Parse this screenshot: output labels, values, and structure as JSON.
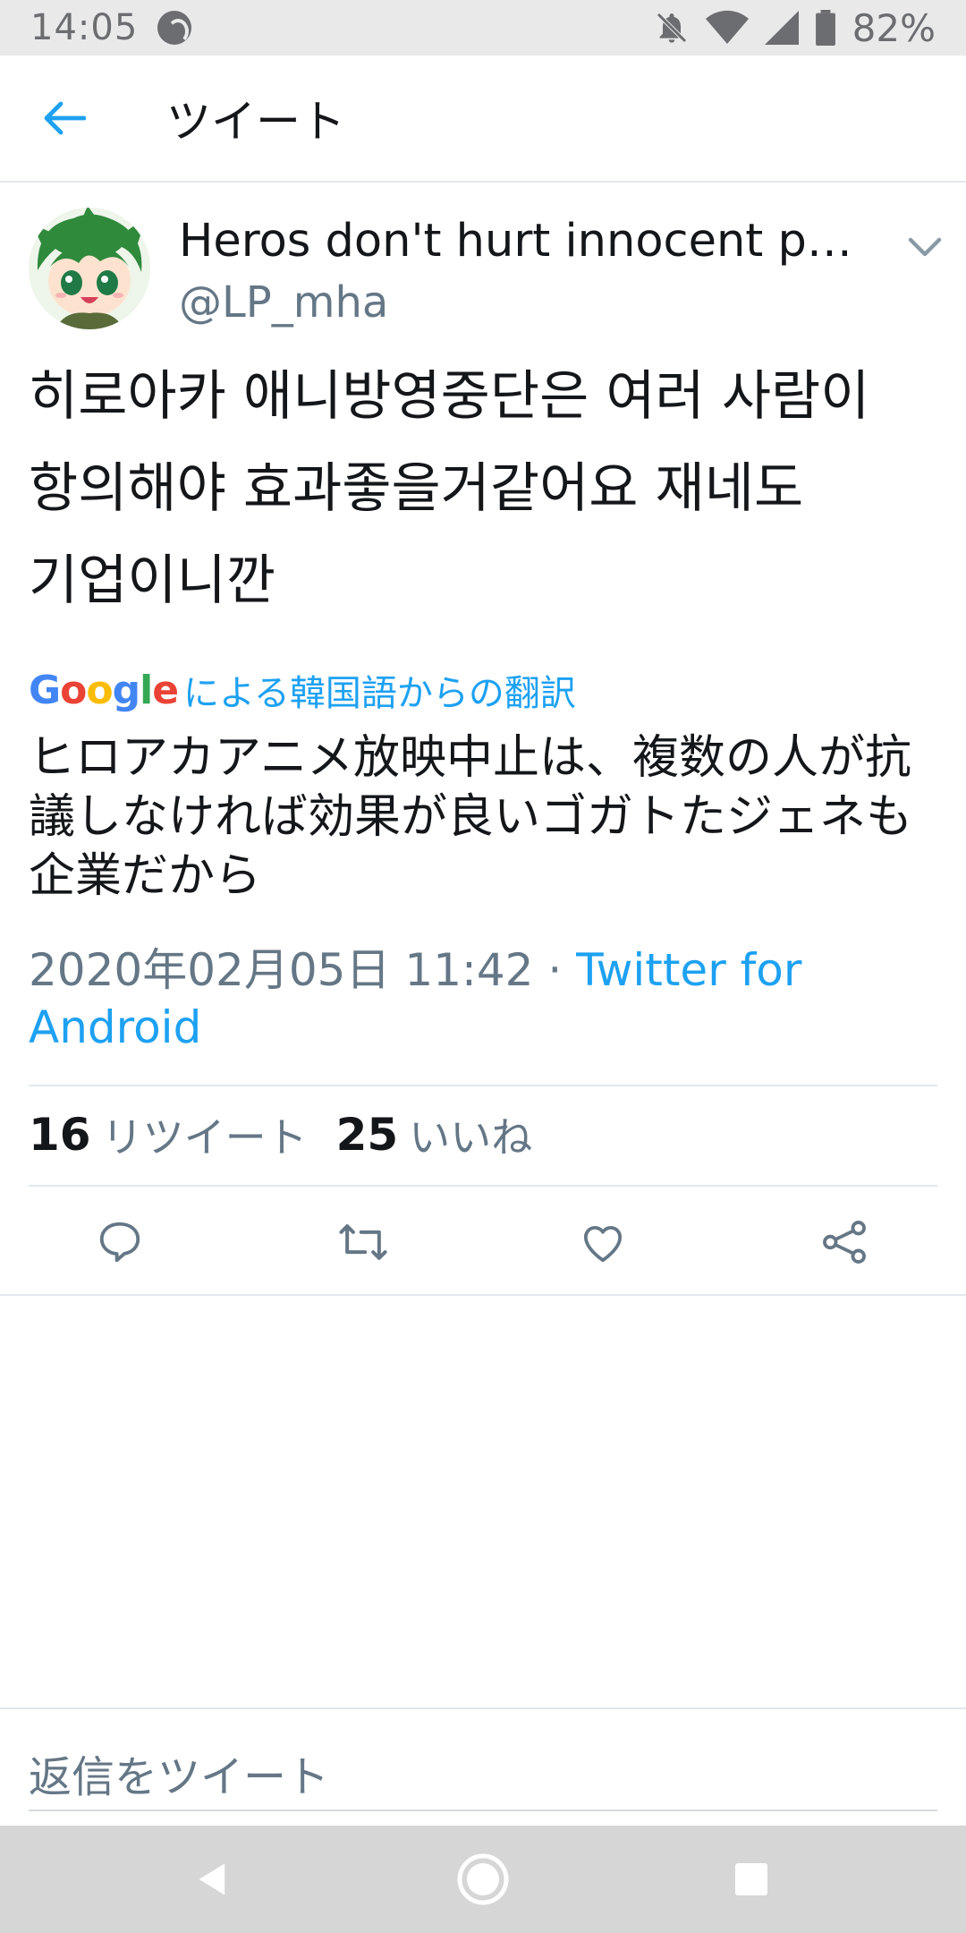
{
  "status_bar": {
    "time": "14:05",
    "battery": "82%",
    "icons": [
      "cast-icon",
      "mute-icon",
      "wifi-icon",
      "signal-icon",
      "battery-icon"
    ]
  },
  "app_bar": {
    "title": "ツイート",
    "back_icon": "arrow-left-icon"
  },
  "tweet": {
    "display_name": "Heros don't hurt innocent pe…",
    "handle": "@LP_mha",
    "text": "히로아카 애니방영중단은 여러 사람이 항의해야 효과좋을거같어요 재네도 기업이니깐",
    "translation_label": {
      "brand": "Google",
      "text": "による韓国語からの翻訳"
    },
    "translated_text": "ヒロアカアニメ放映中止は、複数の人が抗議しなければ効果が良いゴガトたジェネも企業だから",
    "timestamp": "2020年02月05日 11:42",
    "separator": " · ",
    "source": "Twitter for Android",
    "stats": {
      "retweets_count": "16",
      "retweets_label": "リツイート",
      "likes_count": "25",
      "likes_label": "いいね"
    },
    "actions": [
      "reply-icon",
      "retweet-icon",
      "like-icon",
      "share-icon"
    ]
  },
  "reply": {
    "placeholder": "返信をツイート"
  },
  "nav_bar": {
    "buttons": [
      "back-triangle-icon",
      "home-circle-icon",
      "recents-square-icon"
    ]
  },
  "colors": {
    "accent": "#1da1f2",
    "text_primary": "#14171a",
    "text_secondary": "#657786",
    "divider": "#e1e8ed",
    "status_bar_bg": "#e9e9ea",
    "nav_bar_bg": "#d6d6d6"
  }
}
